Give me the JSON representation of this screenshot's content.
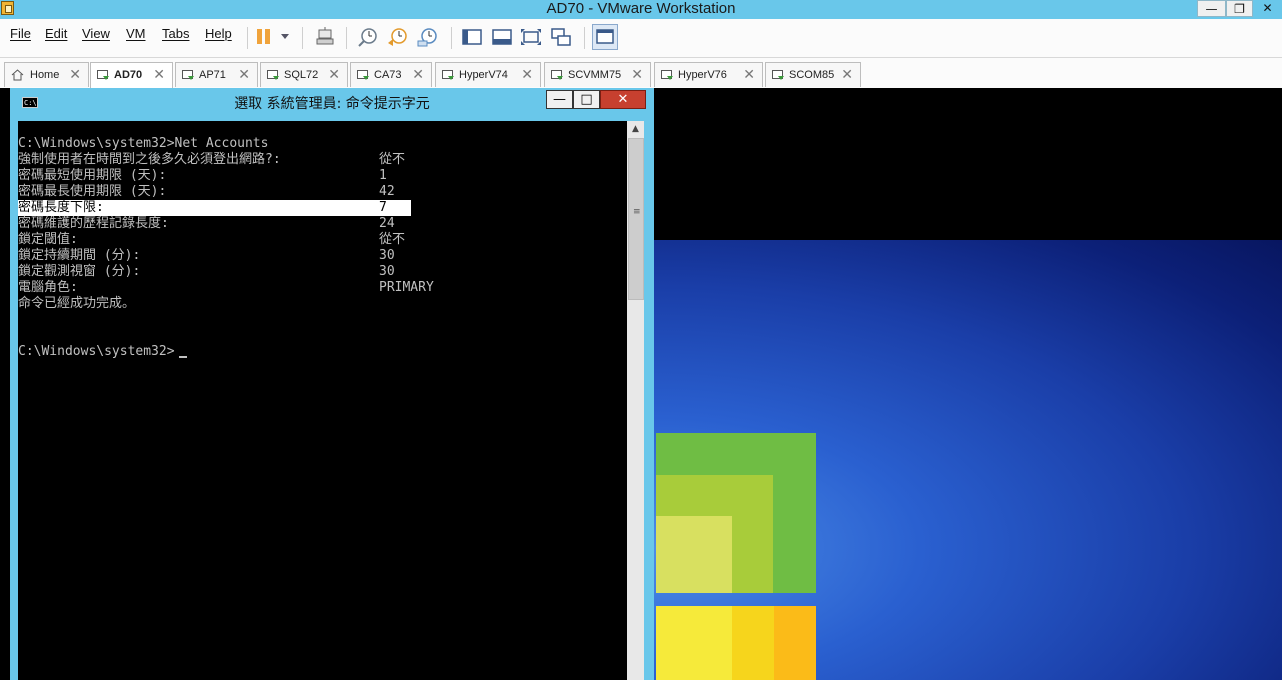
{
  "window": {
    "title": "AD70 - VMware Workstation",
    "controls": {
      "minimize": "—",
      "restore": "❐",
      "close": "✕"
    }
  },
  "menu": [
    "File",
    "Edit",
    "View",
    "VM",
    "Tabs",
    "Help"
  ],
  "toolbar": {
    "icons": [
      "pause-icon",
      "send-ctrl-alt-del-icon",
      "snapshot-icon",
      "revert-snapshot-icon",
      "snapshot-manager-icon",
      "console-view-icon",
      "full-screen-icon",
      "fit-guest-icon",
      "autosize-icon",
      "unity-icon"
    ]
  },
  "tabs": [
    {
      "label": "Home",
      "active": false
    },
    {
      "label": "AD70",
      "active": true
    },
    {
      "label": "AP71",
      "active": false
    },
    {
      "label": "SQL72",
      "active": false
    },
    {
      "label": "CA73",
      "active": false
    },
    {
      "label": "HyperV74",
      "active": false
    },
    {
      "label": "SCVMM75",
      "active": false
    },
    {
      "label": "HyperV76",
      "active": false
    },
    {
      "label": "SCOM85",
      "active": false
    }
  ],
  "tab_close": "✕",
  "cmd": {
    "title": "選取 系統管理員: 命令提示字元",
    "icon_text": "C:\\",
    "controls": {
      "minimize": "—",
      "maximize": "□",
      "close": "✕"
    },
    "prompt_command": "C:\\Windows\\system32>Net Accounts",
    "rows": [
      {
        "key": "強制使用者在時間到之後多久必須登出網路?:",
        "value": "從不"
      },
      {
        "key": "密碼最短使用期限 (天):",
        "value": "1"
      },
      {
        "key": "密碼最長使用期限 (天):",
        "value": "42"
      },
      {
        "key": "密碼長度下限:",
        "value": "7",
        "selected": true
      },
      {
        "key": "密碼維護的歷程記錄長度:",
        "value": "24"
      },
      {
        "key": "鎖定閾值:",
        "value": "從不"
      },
      {
        "key": "鎖定持續期間 (分):",
        "value": "30"
      },
      {
        "key": "鎖定觀測視窗 (分):",
        "value": "30"
      },
      {
        "key": "電腦角色:",
        "value": "PRIMARY"
      }
    ],
    "completion": "命令已經成功完成。",
    "prompt": "C:\\Windows\\system32>",
    "scroll_up": "▲",
    "grip": "≡"
  },
  "colors": {
    "titlebar": "#69c7ea",
    "console_bg": "#000000",
    "console_fg": "#c0c0c0",
    "close_red": "#c7402f"
  }
}
